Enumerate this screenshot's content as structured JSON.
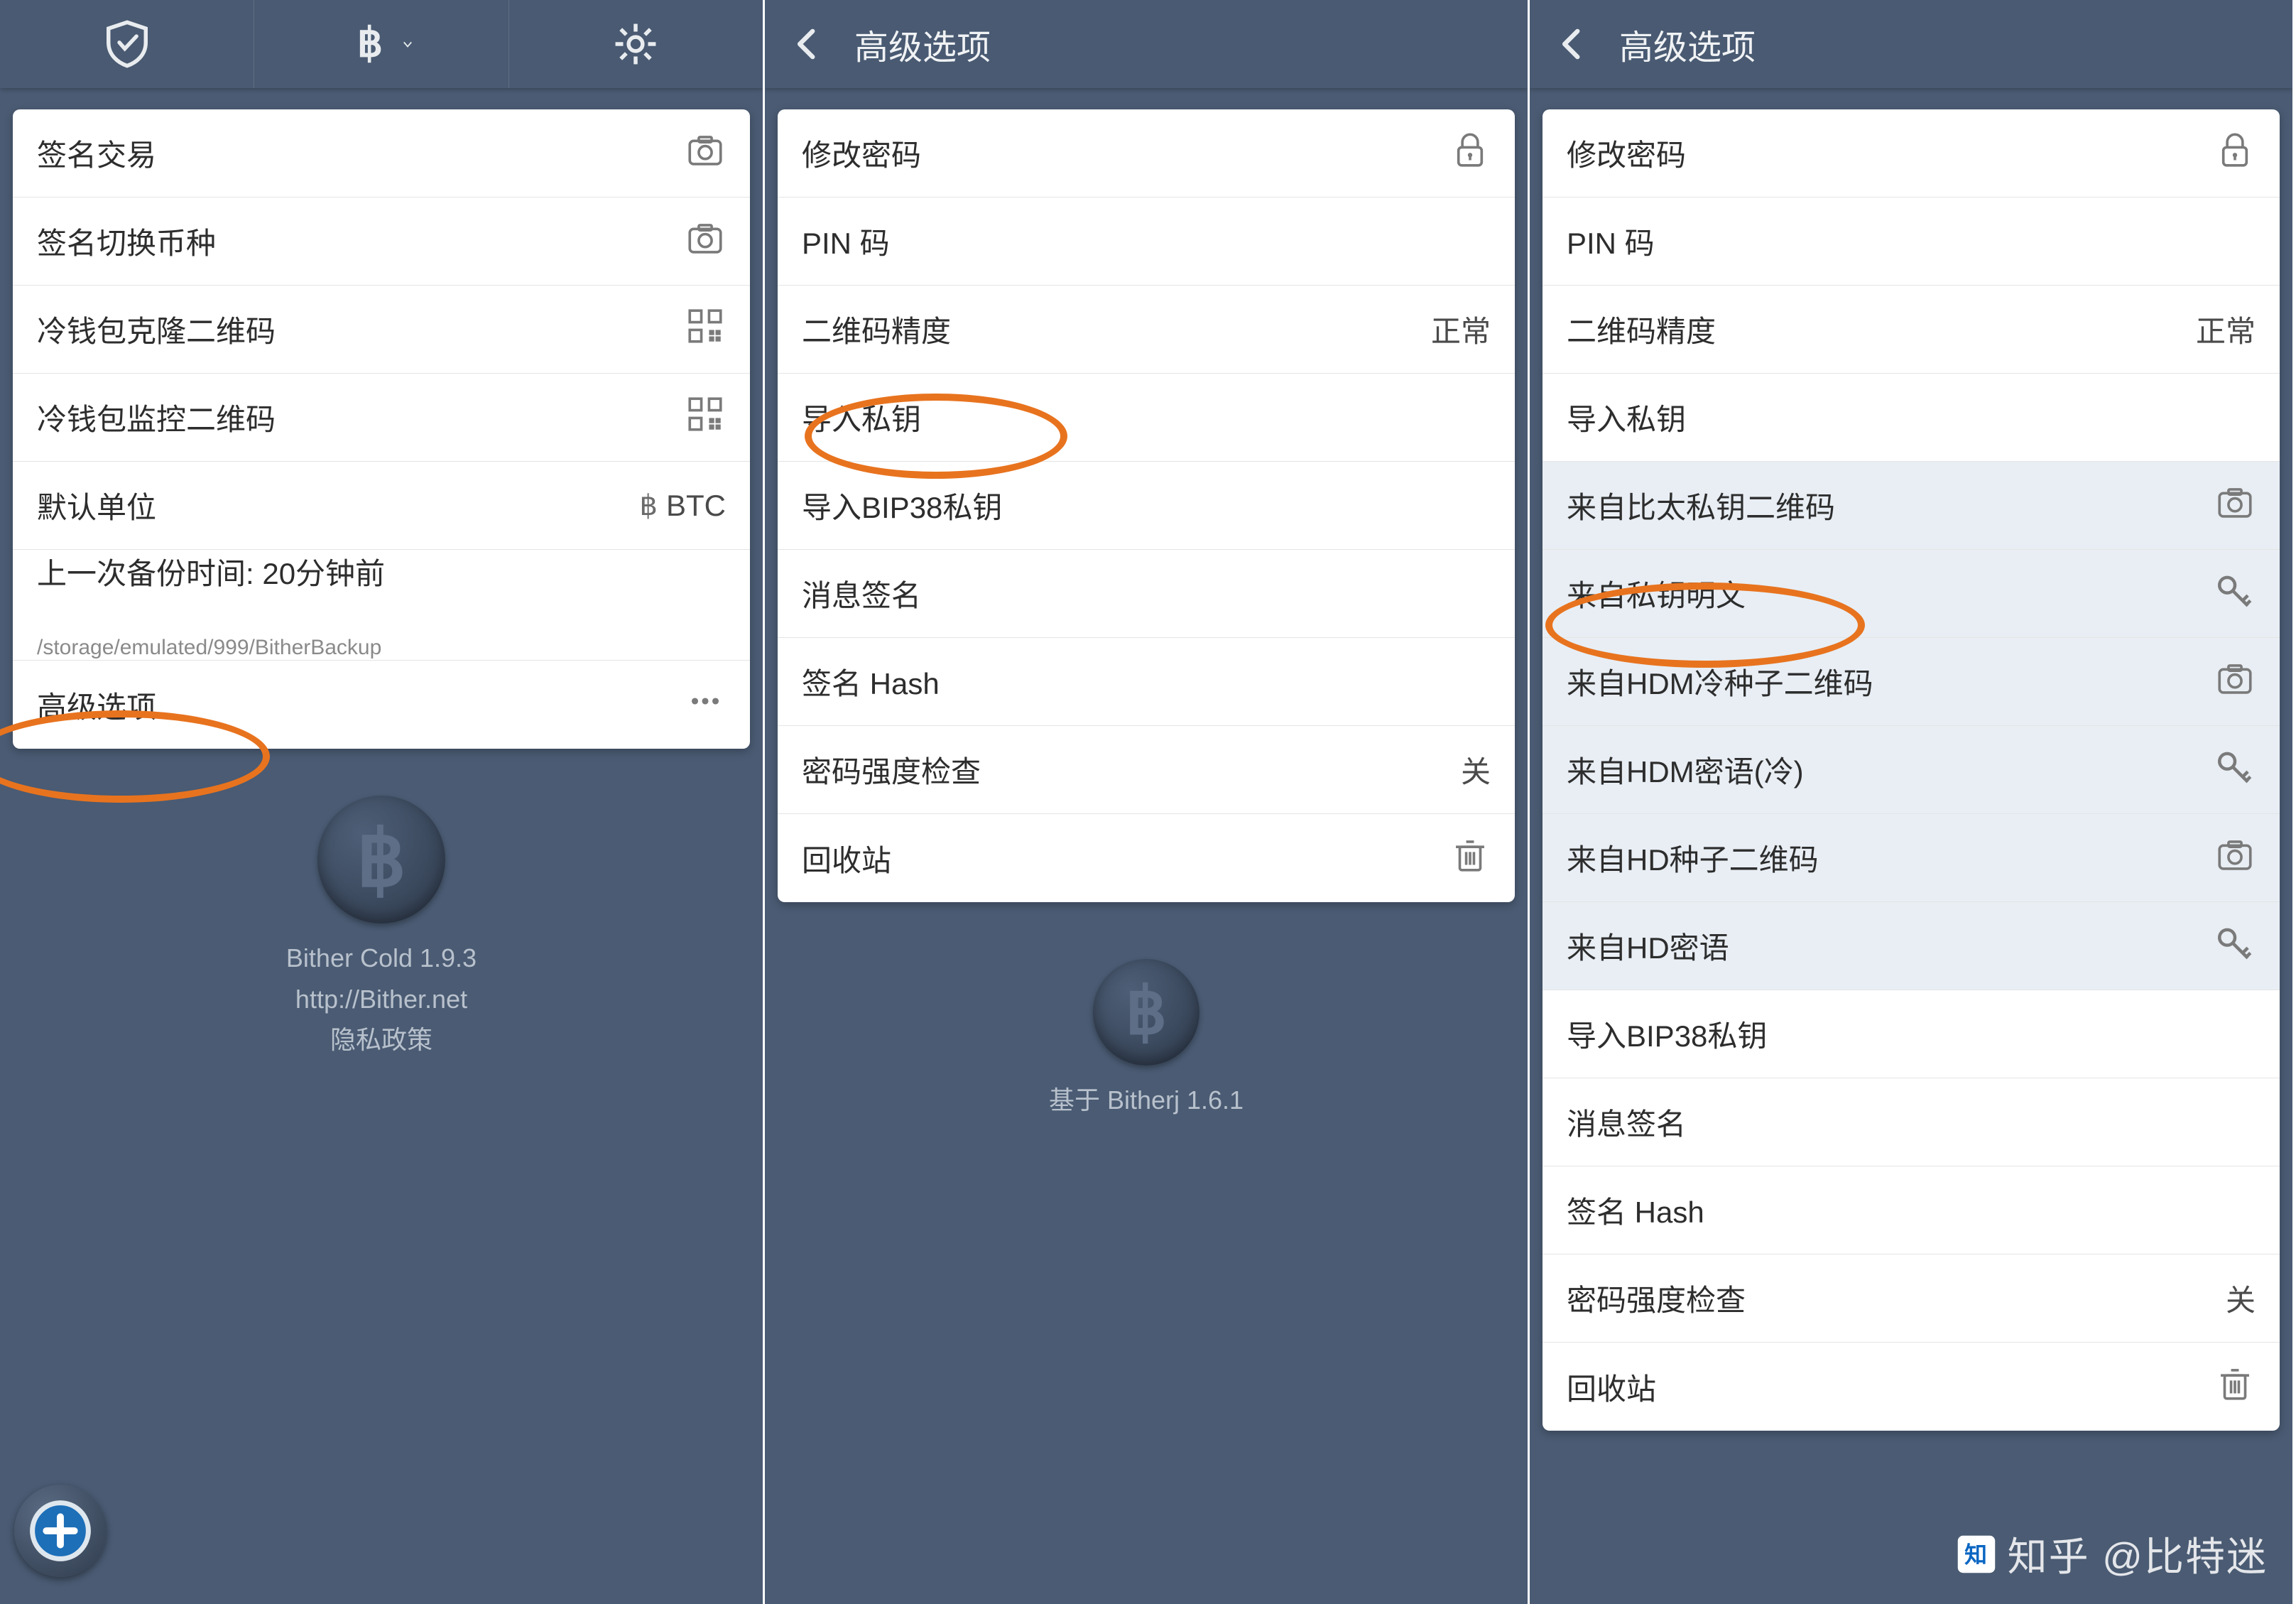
{
  "screen1": {
    "rows": {
      "sign_tx": "签名交易",
      "sign_switch": "签名切换币种",
      "cold_clone_qr": "冷钱包克隆二维码",
      "cold_monitor_qr": "冷钱包监控二维码",
      "default_unit": "默认单位",
      "default_unit_value": "BTC",
      "last_backup": "上一次备份时间: 20分钟前",
      "last_backup_path": "/storage/emulated/999/BitherBackup",
      "advanced": "高级选项"
    },
    "footer": {
      "app_name": "Bither Cold 1.9.3",
      "url": "http://Bither.net",
      "privacy": "隐私政策"
    }
  },
  "screen2": {
    "title": "高级选项",
    "rows": {
      "change_pw": "修改密码",
      "pin": "PIN 码",
      "qr_precision": "二维码精度",
      "qr_precision_val": "正常",
      "import_pk": "导入私钥",
      "import_bip38": "导入BIP38私钥",
      "msg_sign": "消息签名",
      "sign_hash": "签名 Hash",
      "pw_strength": "密码强度检查",
      "pw_strength_val": "关",
      "trash": "回收站"
    },
    "footer": "基于 Bitherj 1.6.1"
  },
  "screen3": {
    "title": "高级选项",
    "rows": {
      "change_pw": "修改密码",
      "pin": "PIN 码",
      "qr_precision": "二维码精度",
      "qr_precision_val": "正常",
      "import_pk": "导入私钥",
      "from_bither_qr": "来自比太私钥二维码",
      "from_pk_text": "来自私钥明文",
      "from_hdm_cold_qr": "来自HDM冷种子二维码",
      "from_hdm_phrase": "来自HDM密语(冷)",
      "from_hd_seed_qr": "来自HD种子二维码",
      "from_hd_phrase": "来自HD密语",
      "import_bip38": "导入BIP38私钥",
      "msg_sign": "消息签名",
      "sign_hash": "签名 Hash",
      "pw_strength": "密码强度检查",
      "pw_strength_val": "关",
      "trash": "回收站"
    }
  },
  "watermark": "知乎 @比特迷"
}
